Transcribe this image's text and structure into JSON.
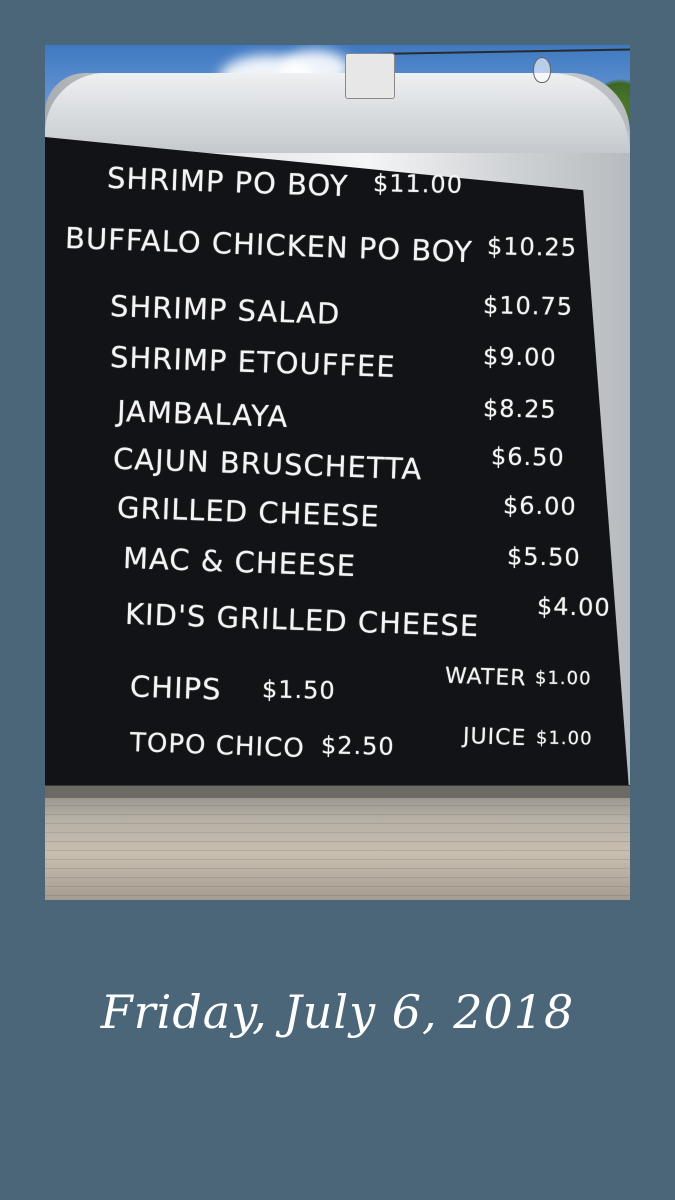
{
  "photo": {
    "board_color": "#111316",
    "background_color": "#4a6678",
    "menu": [
      {
        "name": "SHRIMP PO BOY",
        "price": "$11.00"
      },
      {
        "name": "BUFFALO CHICKEN PO BOY",
        "price": "$10.25"
      },
      {
        "name": "SHRIMP SALAD",
        "price": "$10.75"
      },
      {
        "name": "SHRIMP ETOUFFEE",
        "price": "$9.00"
      },
      {
        "name": "JAMBALAYA",
        "price": "$8.25"
      },
      {
        "name": "CAJUN BRUSCHETTA",
        "price": "$6.50"
      },
      {
        "name": "GRILLED CHEESE",
        "price": "$6.00"
      },
      {
        "name": "MAC & CHEESE",
        "price": "$5.50"
      },
      {
        "name": "KID'S GRILLED CHEESE",
        "price": "$4.00"
      },
      {
        "name": "CHIPS",
        "price": "$1.50"
      },
      {
        "name": "WATER",
        "price": "$1.00"
      },
      {
        "name": "TOPO CHICO",
        "price": "$2.50"
      },
      {
        "name": "JUICE",
        "price": "$1.00"
      }
    ]
  },
  "caption": {
    "date": "Friday, July 6, 2018"
  }
}
